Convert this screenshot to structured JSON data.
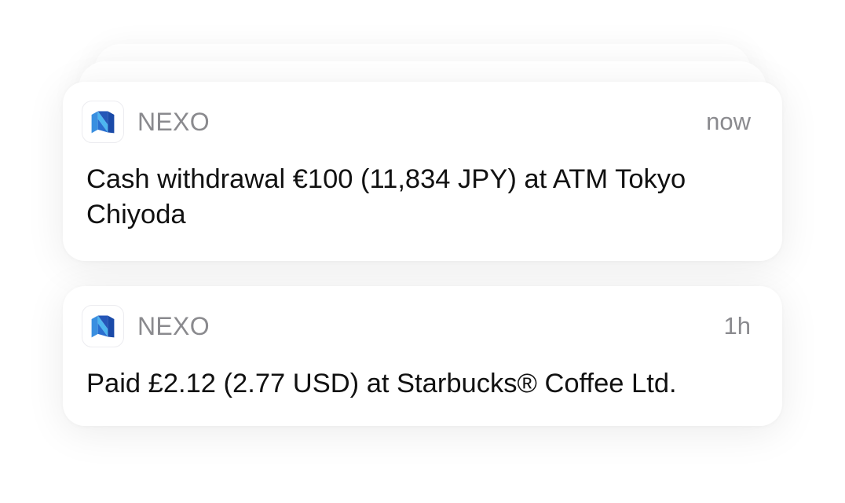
{
  "notifications": [
    {
      "app_name": "NEXO",
      "icon": "nexo-logo-icon",
      "time": "now",
      "message": "Cash withdrawal €100 (11,834 JPY) at ATM Tokyo Chiyoda"
    },
    {
      "app_name": "NEXO",
      "icon": "nexo-logo-icon",
      "time": "1h",
      "message": "Paid £2.12 (2.77 USD) at Starbucks® Coffee Ltd."
    }
  ],
  "colors": {
    "nexo_blue_dark": "#1a4aa8",
    "nexo_blue_light": "#4db6f0",
    "secondary_text": "#8a8a8e",
    "primary_text": "#111111"
  }
}
